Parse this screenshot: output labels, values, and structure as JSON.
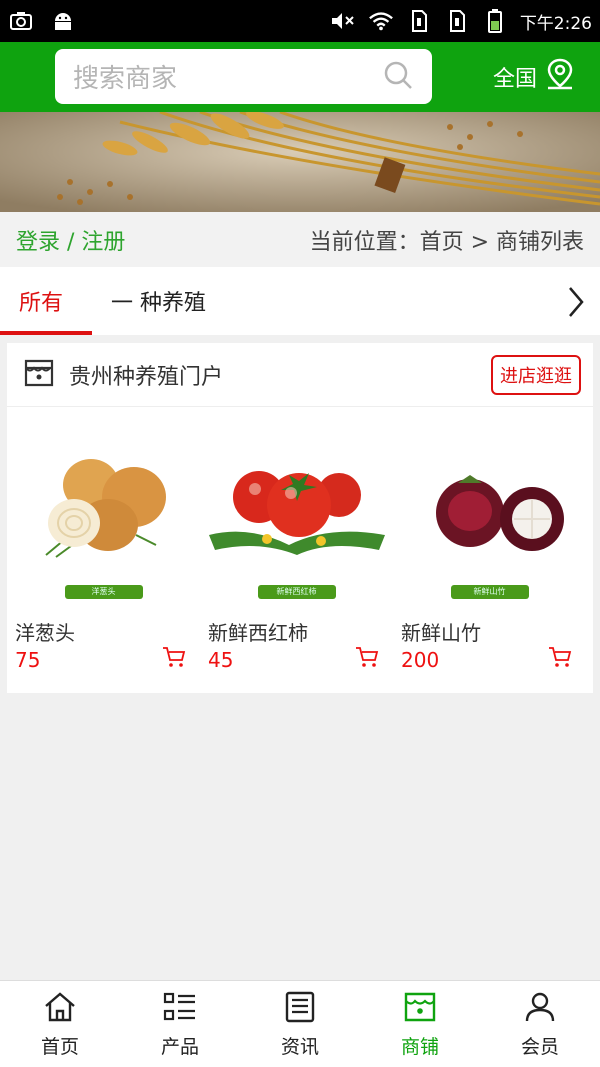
{
  "status_bar": {
    "time": "下午2:26",
    "icons": [
      "camera-icon",
      "android-icon",
      "mute-icon",
      "wifi-icon",
      "sim1-icon",
      "sim2-icon",
      "battery-icon"
    ]
  },
  "header": {
    "search_placeholder": "搜索商家",
    "region_label": "全国"
  },
  "crumb": {
    "login_link": "登录 / 注册",
    "location": "当前位置：首页 > 商铺列表"
  },
  "tabs": {
    "all": "所有",
    "category": "一 种养殖"
  },
  "shop": {
    "name": "贵州种养殖门户",
    "visit_button": "进店逛逛",
    "products": [
      {
        "name": "洋葱头",
        "price": "75",
        "tag": "洋葱头"
      },
      {
        "name": "新鲜西红柿",
        "price": "45",
        "tag": "新鲜西红柿"
      },
      {
        "name": "新鲜山竹",
        "price": "200",
        "tag": "新鲜山竹"
      }
    ]
  },
  "bottom_nav": {
    "items": [
      {
        "label": "首页",
        "icon": "home-icon"
      },
      {
        "label": "产品",
        "icon": "list-icon"
      },
      {
        "label": "资讯",
        "icon": "news-icon"
      },
      {
        "label": "商铺",
        "icon": "shop-icon"
      },
      {
        "label": "会员",
        "icon": "user-icon"
      }
    ],
    "active_index": 3
  },
  "colors": {
    "brand_green": "#0fa30f",
    "accent_red": "#dd1111",
    "link_green": "#2ea42e"
  }
}
